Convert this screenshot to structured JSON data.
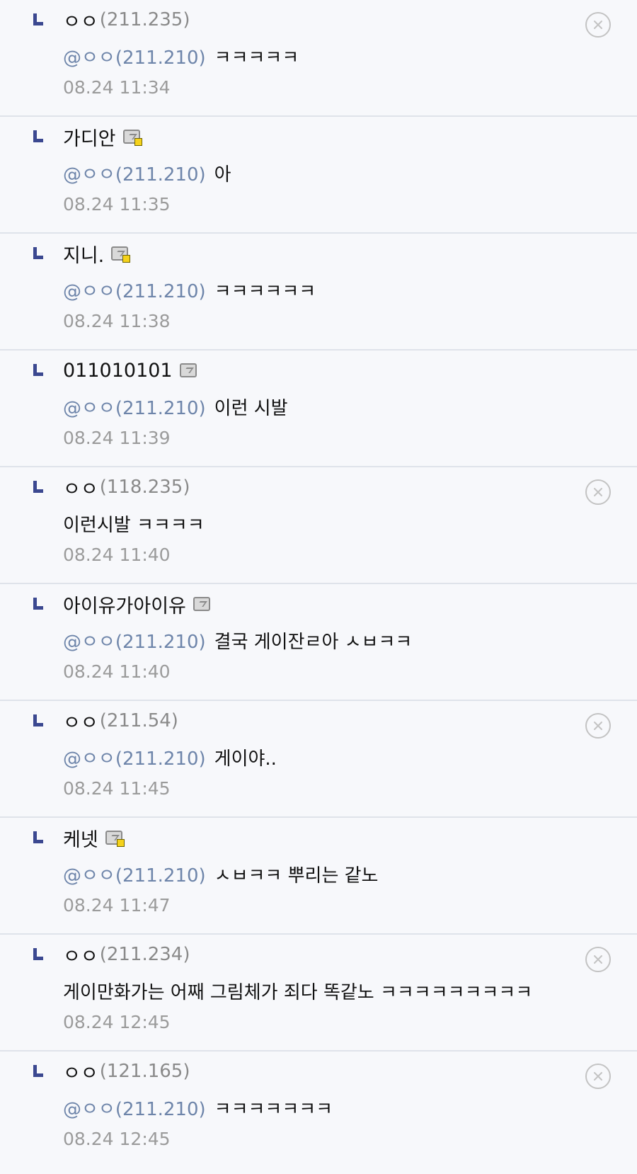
{
  "icons": {
    "reply_arrow": "reply-arrow-icon",
    "gallog": "gallog-icon",
    "fixed_badge": "fixed-nick-badge-icon",
    "delete": "delete-circle-x-icon"
  },
  "colors": {
    "background": "#f7f8fb",
    "divider": "#dfe3ea",
    "arrow": "#3b4890",
    "mention": "#6e85aa",
    "ip": "#8a8a8a",
    "date": "#9b9b9b",
    "delete_icon": "#c3c3c3"
  },
  "replies": [
    {
      "nick": "ㅇㅇ",
      "ip": "(211.235)",
      "mention": "@ㅇㅇ(211.210)",
      "text": "ㅋㅋㅋㅋㅋ",
      "date": "08.24 11:34",
      "gallog": false,
      "fixed": false,
      "deletable": true
    },
    {
      "nick": "가디안",
      "ip": "",
      "mention": "@ㅇㅇ(211.210)",
      "text": "아",
      "date": "08.24 11:35",
      "gallog": true,
      "fixed": true,
      "deletable": false
    },
    {
      "nick": "지니.",
      "ip": "",
      "mention": "@ㅇㅇ(211.210)",
      "text": "ㅋㅋㅋㅋㅋㅋ",
      "date": "08.24 11:38",
      "gallog": true,
      "fixed": true,
      "deletable": false
    },
    {
      "nick": "011010101",
      "ip": "",
      "mention": "@ㅇㅇ(211.210)",
      "text": "이런 시발",
      "date": "08.24 11:39",
      "gallog": true,
      "fixed": false,
      "deletable": false
    },
    {
      "nick": "ㅇㅇ",
      "ip": "(118.235)",
      "mention": "",
      "text": "이런시발 ㅋㅋㅋㅋ",
      "date": "08.24 11:40",
      "gallog": false,
      "fixed": false,
      "deletable": true
    },
    {
      "nick": "아이유가아이유",
      "ip": "",
      "mention": "@ㅇㅇ(211.210)",
      "text": "결국 게이잔ㄹ아 ㅅㅂㅋㅋ",
      "date": "08.24 11:40",
      "gallog": true,
      "fixed": false,
      "deletable": false
    },
    {
      "nick": "ㅇㅇ",
      "ip": "(211.54)",
      "mention": "@ㅇㅇ(211.210)",
      "text": "게이야..",
      "date": "08.24 11:45",
      "gallog": false,
      "fixed": false,
      "deletable": true
    },
    {
      "nick": "케넷",
      "ip": "",
      "mention": "@ㅇㅇ(211.210)",
      "text": "ㅅㅂㅋㅋ 뿌리는 같노",
      "date": "08.24 11:47",
      "gallog": true,
      "fixed": true,
      "deletable": false
    },
    {
      "nick": "ㅇㅇ",
      "ip": "(211.234)",
      "mention": "",
      "text": "게이만화가는 어째 그림체가 죄다 똑같노 ㅋㅋㅋㅋㅋㅋㅋㅋㅋ",
      "date": "08.24 12:45",
      "gallog": false,
      "fixed": false,
      "deletable": true
    },
    {
      "nick": "ㅇㅇ",
      "ip": "(121.165)",
      "mention": "@ㅇㅇ(211.210)",
      "text": "ㅋㅋㅋㅋㅋㅋㅋ",
      "date": "08.24 12:45",
      "gallog": false,
      "fixed": false,
      "deletable": true
    }
  ]
}
